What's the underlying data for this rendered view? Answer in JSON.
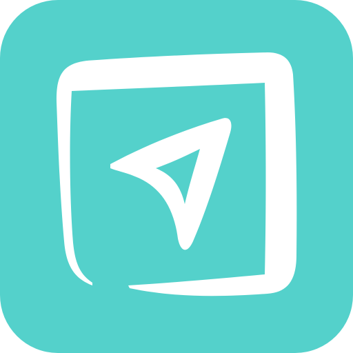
{
  "icon": {
    "name": "navigation-arrow-app-icon",
    "background_color": "#54D1CB",
    "foreground_color": "#FFFFFF"
  }
}
